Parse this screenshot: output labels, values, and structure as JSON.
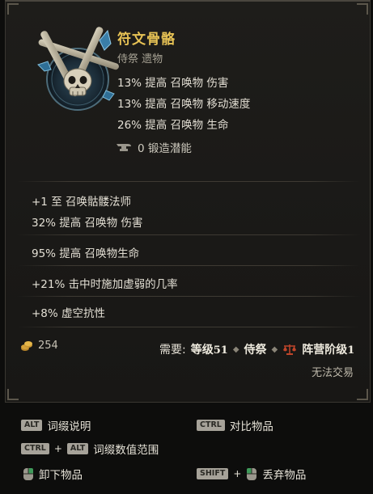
{
  "item": {
    "name": "符文骨骼",
    "subtitle": "侍祭 遗物",
    "implicits": [
      "13% 提高 召唤物 伤害",
      "13% 提高 召唤物 移动速度",
      "26% 提高 召唤物 生命"
    ],
    "forging_potential": "0 锻造潜能",
    "affixes": [
      "+1 至 召唤骷髅法师",
      "32% 提高 召唤物 伤害",
      "95% 提高 召唤物生命",
      "+21% 击中时施加虚弱的几率",
      "+8% 虚空抗性"
    ],
    "gold_value": "254",
    "requirements": {
      "label": "需要:",
      "level_label": "等级",
      "level_value": "51",
      "class": "侍祭",
      "faction_label": "阵营阶级",
      "faction_value": "1"
    },
    "untradable": "无法交易"
  },
  "hints": {
    "alt_key": "ALT",
    "ctrl_key": "CTRL",
    "shift_key": "SHIFT",
    "plus": "+",
    "affix_desc": "词缀说明",
    "compare": "对比物品",
    "affix_range": "词缀数值范围",
    "unequip": "卸下物品",
    "drop": "丢弃物品"
  },
  "colors": {
    "name": "#e7c255",
    "text": "#e3dfd4",
    "background": "#1c1b18"
  },
  "icons": [
    "relic-skull-bones-icon",
    "anvil-icon",
    "gold-coins-icon",
    "faction-scales-icon",
    "left-mouse-icon",
    "right-mouse-icon"
  ]
}
